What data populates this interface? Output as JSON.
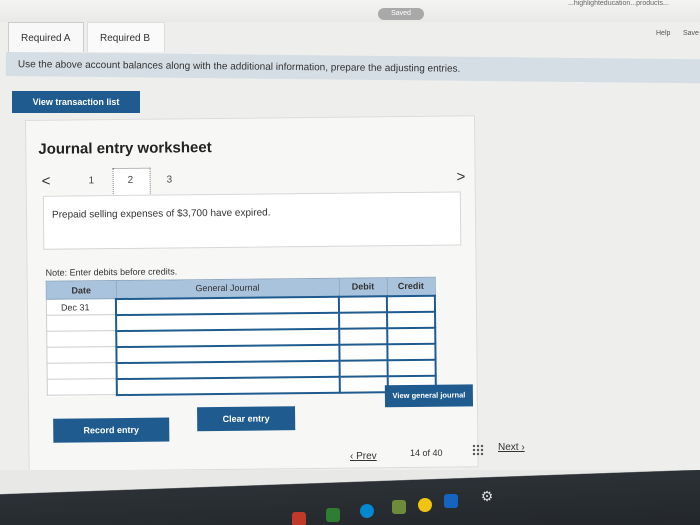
{
  "topbar": {
    "saved_badge": "Saved",
    "url_fragment": "...highlighteducation...products...",
    "help_label": "Help",
    "save_label": "Save"
  },
  "tabs": [
    {
      "label": "Required A"
    },
    {
      "label": "Required B"
    }
  ],
  "instruction": "Use the above account balances along with the additional information, prepare the adjusting entries.",
  "view_transaction_list_label": "View transaction list",
  "worksheet": {
    "title": "Journal entry worksheet",
    "nav": {
      "prev": "<",
      "next": ">",
      "pages": [
        "1",
        "2",
        "3"
      ],
      "current": "2"
    },
    "description": "Prepaid selling expenses of $3,700 have expired.",
    "note": "Note: Enter debits before credits.",
    "table": {
      "headers": {
        "date": "Date",
        "account": "General Journal",
        "debit": "Debit",
        "credit": "Credit"
      },
      "rows": [
        {
          "date": "Dec 31",
          "account": "",
          "debit": "",
          "credit": ""
        },
        {
          "date": "",
          "account": "",
          "debit": "",
          "credit": ""
        },
        {
          "date": "",
          "account": "",
          "debit": "",
          "credit": ""
        },
        {
          "date": "",
          "account": "",
          "debit": "",
          "credit": ""
        },
        {
          "date": "",
          "account": "",
          "debit": "",
          "credit": ""
        },
        {
          "date": "",
          "account": "",
          "debit": "",
          "credit": ""
        }
      ]
    },
    "record_entry_label": "Record entry",
    "clear_entry_label": "Clear entry",
    "view_general_journal_label": "View general journal"
  },
  "pager": {
    "prev": "Prev",
    "info": "14 of 40",
    "next": "Next"
  },
  "colors": {
    "primary_button": "#1f5b8f",
    "table_header": "#a9c3dc",
    "instruction_band": "#d5dee5"
  }
}
